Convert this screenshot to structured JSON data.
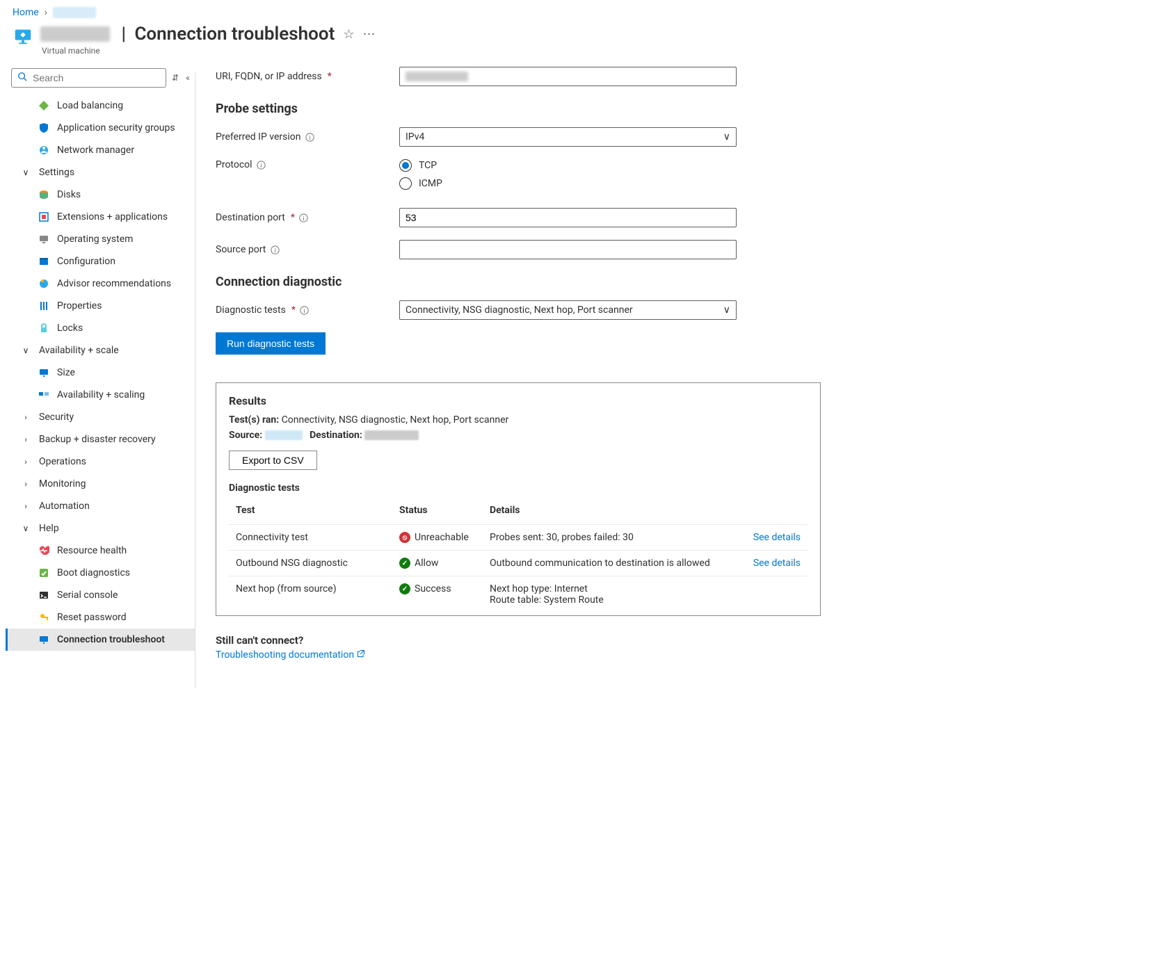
{
  "breadcrumb": {
    "home": "Home"
  },
  "header": {
    "title_suffix": "Connection troubleshoot",
    "subtitle": "Virtual machine"
  },
  "search": {
    "placeholder": "Search"
  },
  "sidebar": {
    "top": [
      {
        "label": "Load balancing"
      },
      {
        "label": "Application security groups"
      },
      {
        "label": "Network manager"
      }
    ],
    "settings_label": "Settings",
    "settings": [
      {
        "label": "Disks"
      },
      {
        "label": "Extensions + applications"
      },
      {
        "label": "Operating system"
      },
      {
        "label": "Configuration"
      },
      {
        "label": "Advisor recommendations"
      },
      {
        "label": "Properties"
      },
      {
        "label": "Locks"
      }
    ],
    "avail_label": "Availability + scale",
    "avail": [
      {
        "label": "Size"
      },
      {
        "label": "Availability + scaling"
      }
    ],
    "collapsed": [
      "Security",
      "Backup + disaster recovery",
      "Operations",
      "Monitoring",
      "Automation"
    ],
    "help_label": "Help",
    "help": [
      {
        "label": "Resource health"
      },
      {
        "label": "Boot diagnostics"
      },
      {
        "label": "Serial console"
      },
      {
        "label": "Reset password"
      },
      {
        "label": "Connection troubleshoot"
      }
    ]
  },
  "form": {
    "uri_label": "URI, FQDN, or IP address",
    "probe_heading": "Probe settings",
    "ipver_label": "Preferred IP version",
    "ipver_value": "IPv4",
    "protocol_label": "Protocol",
    "protocol_opts": {
      "tcp": "TCP",
      "icmp": "ICMP"
    },
    "dport_label": "Destination port",
    "dport_value": "53",
    "sport_label": "Source port",
    "diag_heading": "Connection diagnostic",
    "tests_label": "Diagnostic tests",
    "tests_value": "Connectivity, NSG diagnostic, Next hop, Port scanner",
    "run_btn": "Run diagnostic tests"
  },
  "results": {
    "heading": "Results",
    "tests_ran_label": "Test(s) ran:",
    "tests_ran": "Connectivity, NSG diagnostic, Next hop, Port scanner",
    "source_label": "Source:",
    "dest_label": "Destination:",
    "export_btn": "Export to CSV",
    "diag_heading": "Diagnostic tests",
    "cols": {
      "test": "Test",
      "status": "Status",
      "details": "Details"
    },
    "rows": [
      {
        "test": "Connectivity test",
        "status": "Unreachable",
        "status_kind": "bad",
        "details": "Probes sent: 30, probes failed: 30",
        "link": "See details"
      },
      {
        "test": "Outbound NSG diagnostic",
        "status": "Allow",
        "status_kind": "ok",
        "details": "Outbound communication to destination is allowed",
        "link": "See details"
      },
      {
        "test": "Next hop (from source)",
        "status": "Success",
        "status_kind": "ok",
        "details": "Next hop type: Internet\nRoute table: System Route",
        "link": ""
      }
    ]
  },
  "footer": {
    "q": "Still can't connect?",
    "link": "Troubleshooting documentation"
  }
}
